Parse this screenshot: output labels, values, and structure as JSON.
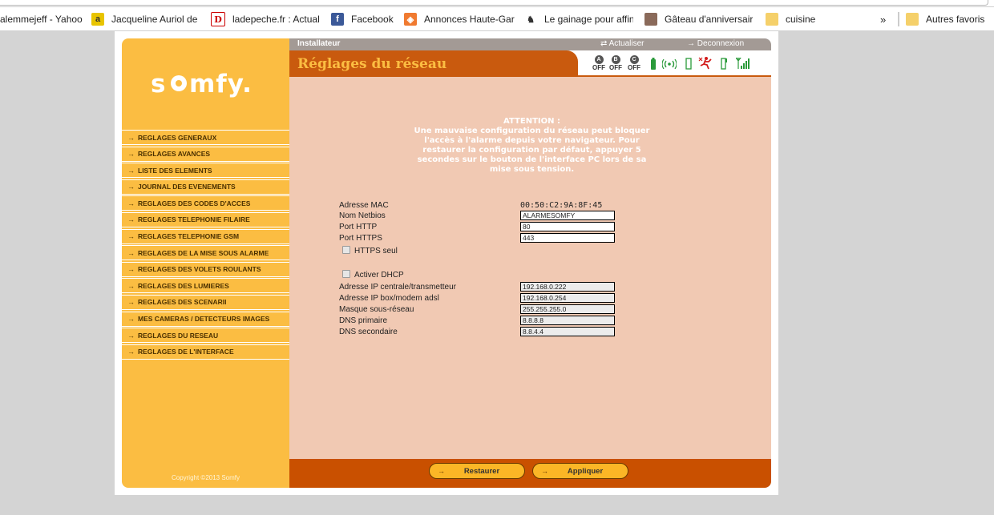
{
  "bookmarks": [
    {
      "label": "alemmejeff - Yahoo",
      "icon": "yahoo-icon"
    },
    {
      "label": "Jacqueline Auriol de",
      "icon": "site-icon"
    },
    {
      "label": "ladepeche.fr : Actual",
      "icon": "ladepeche-icon"
    },
    {
      "label": "Facebook",
      "icon": "facebook-icon"
    },
    {
      "label": "Annonces Haute-Gar",
      "icon": "annonces-icon"
    },
    {
      "label": "Le gainage pour affin",
      "icon": "gainage-icon"
    },
    {
      "label": "Gâteau d'anniversair",
      "icon": "gateau-icon"
    },
    {
      "label": "cuisine",
      "icon": "folder-icon"
    }
  ],
  "bookmarks_more": "»",
  "other_bookmarks": "Autres favoris",
  "app": {
    "logo": "somfy.",
    "copyright": "Copyright ©2013 Somfy"
  },
  "topbar": {
    "role": "Installateur",
    "refresh": "Actualiser",
    "logout": "Deconnexion"
  },
  "page_title": "Réglages du réseau",
  "status": {
    "zone_a": {
      "letter": "A",
      "state": "OFF"
    },
    "zone_b": {
      "letter": "B",
      "state": "OFF"
    },
    "zone_c": {
      "letter": "C",
      "state": "OFF"
    }
  },
  "nav": [
    "REGLAGES GENERAUX",
    "REGLAGES AVANCES",
    "LISTE DES ELEMENTS",
    "JOURNAL DES EVENEMENTS",
    "REGLAGES DES CODES D'ACCES",
    "REGLAGES TELEPHONIE FILAIRE",
    "REGLAGES TELEPHONIE GSM",
    "REGLAGES DE LA MISE SOUS ALARME",
    "REGLAGES DES VOLETS ROULANTS",
    "REGLAGES DES LUMIERES",
    "REGLAGES DES SCENARII",
    "MES CAMERAS / DETECTEURS IMAGES",
    "REGLAGES DU RESEAU",
    "REGLAGES DE L'INTERFACE"
  ],
  "warning": {
    "title": "ATTENTION :",
    "body": "Une mauvaise configuration du réseau peut bloquer l'accès à l'alarme depuis votre navigateur. Pour restaurer la configuration par défaut, appuyer 5 secondes sur le bouton de l'interface PC lors de sa mise sous tension."
  },
  "form": {
    "mac_label": "Adresse MAC",
    "mac_value": "00:50:C2:9A:8F:45",
    "netbios_label": "Nom Netbios",
    "netbios_value": "ALARMESOMFY",
    "http_label": "Port HTTP",
    "http_value": "80",
    "https_label": "Port HTTPS",
    "https_value": "443",
    "https_only_label": "HTTPS seul",
    "dhcp_label": "Activer DHCP",
    "ip_label": "Adresse IP centrale/transmetteur",
    "ip_value": "192.168.0.222",
    "gateway_label": "Adresse IP box/modem adsl",
    "gateway_value": "192.168.0.254",
    "mask_label": "Masque sous-réseau",
    "mask_value": "255.255.255.0",
    "dns1_label": "DNS primaire",
    "dns1_value": "8.8.8.8",
    "dns2_label": "DNS secondaire",
    "dns2_value": "8.8.4.4"
  },
  "buttons": {
    "restore": "Restaurer",
    "apply": "Appliquer"
  },
  "colors": {
    "sidebar": "#fbbd42",
    "accent": "#c95a0e",
    "content": "#f1c9b3"
  }
}
